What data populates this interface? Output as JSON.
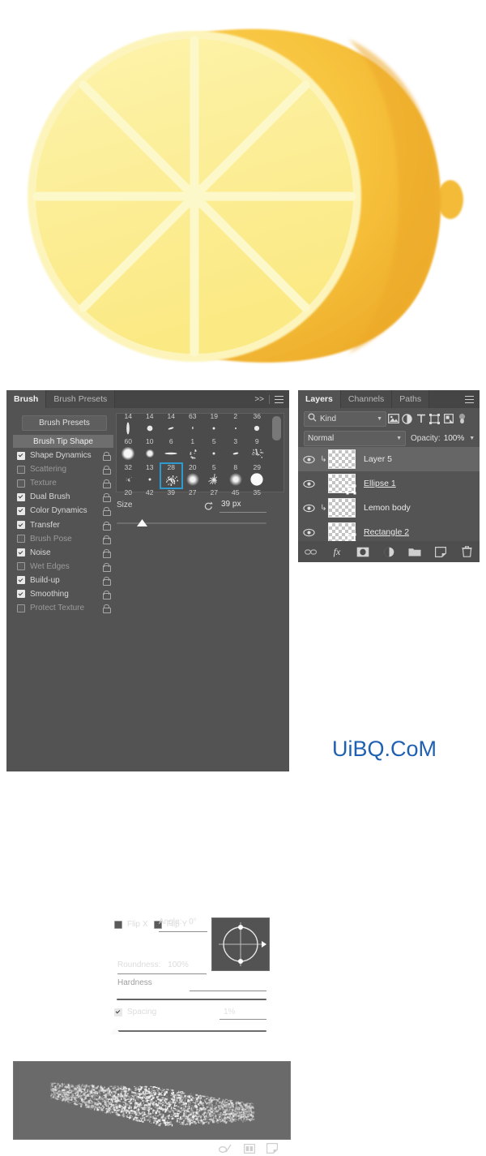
{
  "artwork": {
    "name": "lemon-half-illustration",
    "colors": {
      "rind_outer": "#f7c23e",
      "rind_shadow": "#e8a92c",
      "pulp": "#fbeb8f",
      "pulp_light": "#fdf6c0",
      "segment_divider": "#fdf8c9",
      "nub": "#f6c03c"
    },
    "segments": 8
  },
  "brush_panel": {
    "tabs": [
      {
        "label": "Brush",
        "active": true
      },
      {
        "label": "Brush Presets",
        "active": false
      }
    ],
    "collapse_icon": ">>",
    "menu_icon": "hamburger-icon",
    "brush_presets_button": "Brush Presets",
    "brush_tip_shape": "Brush Tip Shape",
    "dynamics": [
      {
        "label": "Shape Dynamics",
        "checked": true
      },
      {
        "label": "Scattering",
        "checked": false
      },
      {
        "label": "Texture",
        "checked": false
      },
      {
        "label": "Dual Brush",
        "checked": true
      },
      {
        "label": "Color Dynamics",
        "checked": true
      },
      {
        "label": "Transfer",
        "checked": true
      },
      {
        "label": "Brush Pose",
        "checked": false
      },
      {
        "label": "Noise",
        "checked": true
      },
      {
        "label": "Wet Edges",
        "checked": false
      },
      {
        "label": "Build-up",
        "checked": true
      },
      {
        "label": "Smoothing",
        "checked": true
      },
      {
        "label": "Protect Texture",
        "checked": false
      }
    ],
    "brush_grid": {
      "rows": [
        [
          {
            "size": "14",
            "shape": "thin-vertical-stroke"
          },
          {
            "size": "14",
            "shape": "small-round"
          },
          {
            "size": "14",
            "shape": "small-flat-tilt"
          },
          {
            "size": "63",
            "shape": "tiny-speck"
          },
          {
            "size": "19",
            "shape": "tiny-dot"
          },
          {
            "size": "2",
            "shape": "tiny-point"
          },
          {
            "size": "36",
            "shape": "small-round-soft"
          }
        ],
        [
          {
            "size": "60",
            "shape": "large-soft-round"
          },
          {
            "size": "10",
            "shape": "medium-soft-round"
          },
          {
            "size": "6",
            "shape": "flat-ellipse"
          },
          {
            "size": "1",
            "shape": "scatter-texture"
          },
          {
            "size": "5",
            "shape": "tiny-dot"
          },
          {
            "size": "3",
            "shape": "small-flat"
          },
          {
            "size": "9",
            "shape": "rough-texture-round"
          }
        ],
        [
          {
            "size": "32",
            "shape": "wispy-flat"
          },
          {
            "size": "13",
            "shape": "tiny-dot"
          },
          {
            "size": "28",
            "shape": "chalk-texture",
            "selected": true
          },
          {
            "size": "20",
            "shape": "soft-round"
          },
          {
            "size": "5",
            "shape": "splatter-star"
          },
          {
            "size": "8",
            "shape": "soft-round"
          },
          {
            "size": "29",
            "shape": "hard-round"
          }
        ],
        [
          {
            "size": "20"
          },
          {
            "size": "42"
          },
          {
            "size": "39"
          },
          {
            "size": "27"
          },
          {
            "size": "27"
          },
          {
            "size": "45"
          },
          {
            "size": "35"
          }
        ]
      ]
    },
    "size": {
      "label": "Size",
      "value": "39 px",
      "reset_icon": "reset-arrow-icon",
      "slider_pct": 17
    },
    "flip_x": {
      "label": "Flip X",
      "checked": false
    },
    "flip_y": {
      "label": "Flip Y",
      "checked": false
    },
    "angle": {
      "label": "Angle:",
      "value": "0°"
    },
    "roundness": {
      "label": "Roundness:",
      "value": "100%"
    },
    "hardness": {
      "label": "Hardness",
      "enabled": false,
      "slider_pct": 0
    },
    "spacing": {
      "label": "Spacing",
      "value": "1%",
      "checked": true,
      "slider_pct": 1
    },
    "footer_icons": [
      "brush-stroke-icon",
      "new-preset-icon",
      "create-new-brush-icon"
    ]
  },
  "layers_panel": {
    "tabs": [
      {
        "label": "Layers",
        "active": true
      },
      {
        "label": "Channels",
        "active": false
      },
      {
        "label": "Paths",
        "active": false
      }
    ],
    "menu_icon": "hamburger-icon",
    "filter": {
      "kind_label": "Kind",
      "search_icon": "magnifier-icon",
      "icons": [
        "pixel-filter-icon",
        "adjustment-filter-icon",
        "type-filter-icon",
        "shape-filter-icon",
        "smart-object-filter-icon"
      ],
      "toggle_icon": "filter-power-toggle"
    },
    "blend_mode": "Normal",
    "opacity_label": "Opacity:",
    "opacity_value": "100%",
    "layers": [
      {
        "name": "Layer 5",
        "visible": true,
        "selected": true,
        "clipped": true,
        "underline": false,
        "vector": false
      },
      {
        "name": "Ellipse 1",
        "visible": true,
        "selected": false,
        "clipped": false,
        "underline": true,
        "vector": true
      },
      {
        "name": "Lemon body",
        "visible": true,
        "selected": false,
        "clipped": true,
        "underline": false,
        "vector": false
      },
      {
        "name": "Rectangle 2",
        "visible": true,
        "selected": false,
        "clipped": false,
        "underline": true,
        "vector": true
      }
    ],
    "footer_icons": [
      "link-layers-icon",
      "fx-icon",
      "layer-mask-icon",
      "adjustment-layer-icon",
      "new-group-icon",
      "new-layer-icon",
      "delete-layer-icon"
    ]
  },
  "watermark": {
    "text": "UiBQ.CoM",
    "color": "#1f60b0"
  }
}
